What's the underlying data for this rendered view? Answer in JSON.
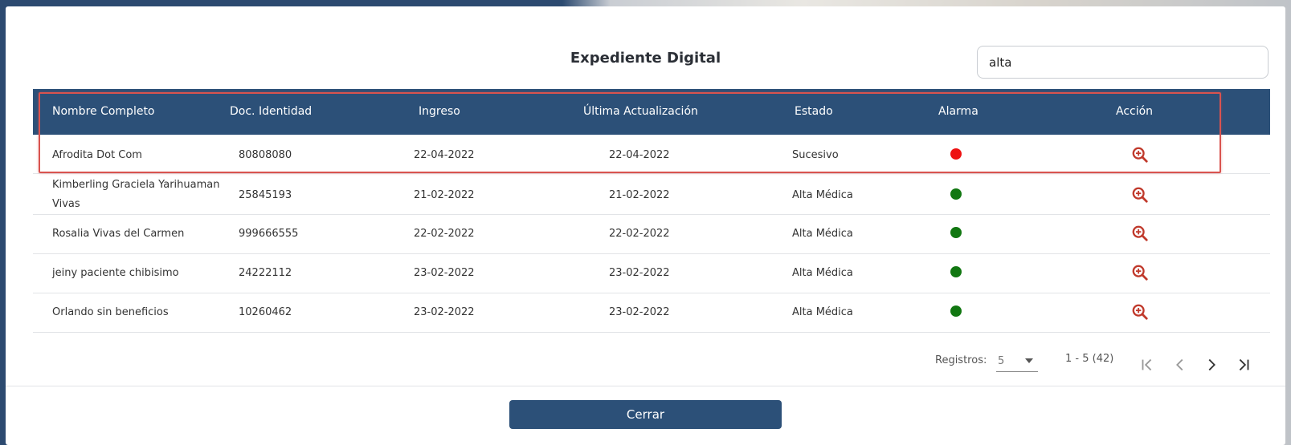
{
  "modal": {
    "title": "Expediente Digital",
    "search_value": "alta",
    "close_label": "Cerrar"
  },
  "table": {
    "headers": {
      "nombre": "Nombre Completo",
      "doc": "Doc. Identidad",
      "ingreso": "Ingreso",
      "actualizacion": "Última Actualización",
      "estado": "Estado",
      "alarma": "Alarma",
      "accion": "Acción"
    },
    "rows": [
      {
        "nombre": "Afrodita Dot Com",
        "doc": "80808080",
        "ingreso": "22-04-2022",
        "actualizacion": "22-04-2022",
        "estado": "Sucesivo",
        "alarma": "red"
      },
      {
        "nombre_line1": "Kimberling Graciela Yarihuaman",
        "nombre_line2": "Vivas",
        "doc": "25845193",
        "ingreso": "21-02-2022",
        "actualizacion": "21-02-2022",
        "estado": "Alta Médica",
        "alarma": "green"
      },
      {
        "nombre": "Rosalia Vivas del Carmen",
        "doc": "999666555",
        "ingreso": "22-02-2022",
        "actualizacion": "22-02-2022",
        "estado": "Alta Médica",
        "alarma": "green"
      },
      {
        "nombre": "jeiny paciente chibisimo",
        "doc": "24222112",
        "ingreso": "23-02-2022",
        "actualizacion": "23-02-2022",
        "estado": "Alta Médica",
        "alarma": "green"
      },
      {
        "nombre": "Orlando sin beneficios",
        "doc": "10260462",
        "ingreso": "23-02-2022",
        "actualizacion": "23-02-2022",
        "estado": "Alta Médica",
        "alarma": "green"
      }
    ],
    "action_icon": "zoom-in-icon"
  },
  "pagination": {
    "registros_label": "Registros:",
    "page_size": "5",
    "range": "1 - 5 (42)"
  },
  "colors": {
    "header_bg": "#2c5078",
    "alarm_red": "#ee1111",
    "alarm_green": "#117711",
    "action_icon": "#c0392b",
    "highlight_border": "#d9534f"
  }
}
